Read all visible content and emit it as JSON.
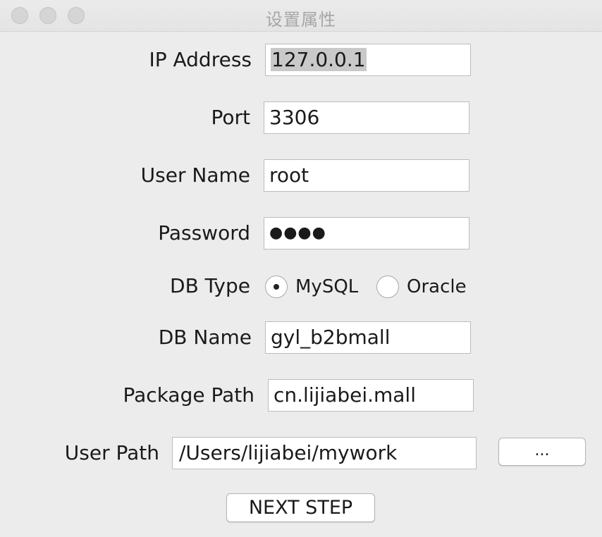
{
  "window": {
    "title": "设置属性"
  },
  "form": {
    "ip_label": "IP  Address",
    "ip_value": "127.0.0.1",
    "port_label": "Port",
    "port_value": "3306",
    "user_label": "User Name",
    "user_value": "root",
    "password_label": "Password",
    "password_mask": "●●●●",
    "dbtype_label": "DB Type",
    "dbtype_options": [
      "MySQL",
      "Oracle"
    ],
    "dbtype_selected": "MySQL",
    "dbname_label": "DB Name",
    "dbname_value": "gyl_b2bmall",
    "package_label": "Package Path",
    "package_value": "cn.lijiabei.mall",
    "userpath_label": "User Path",
    "userpath_value": "/Users/lijiabei/mywork",
    "browse_label": "...",
    "next_label": "NEXT STEP"
  }
}
